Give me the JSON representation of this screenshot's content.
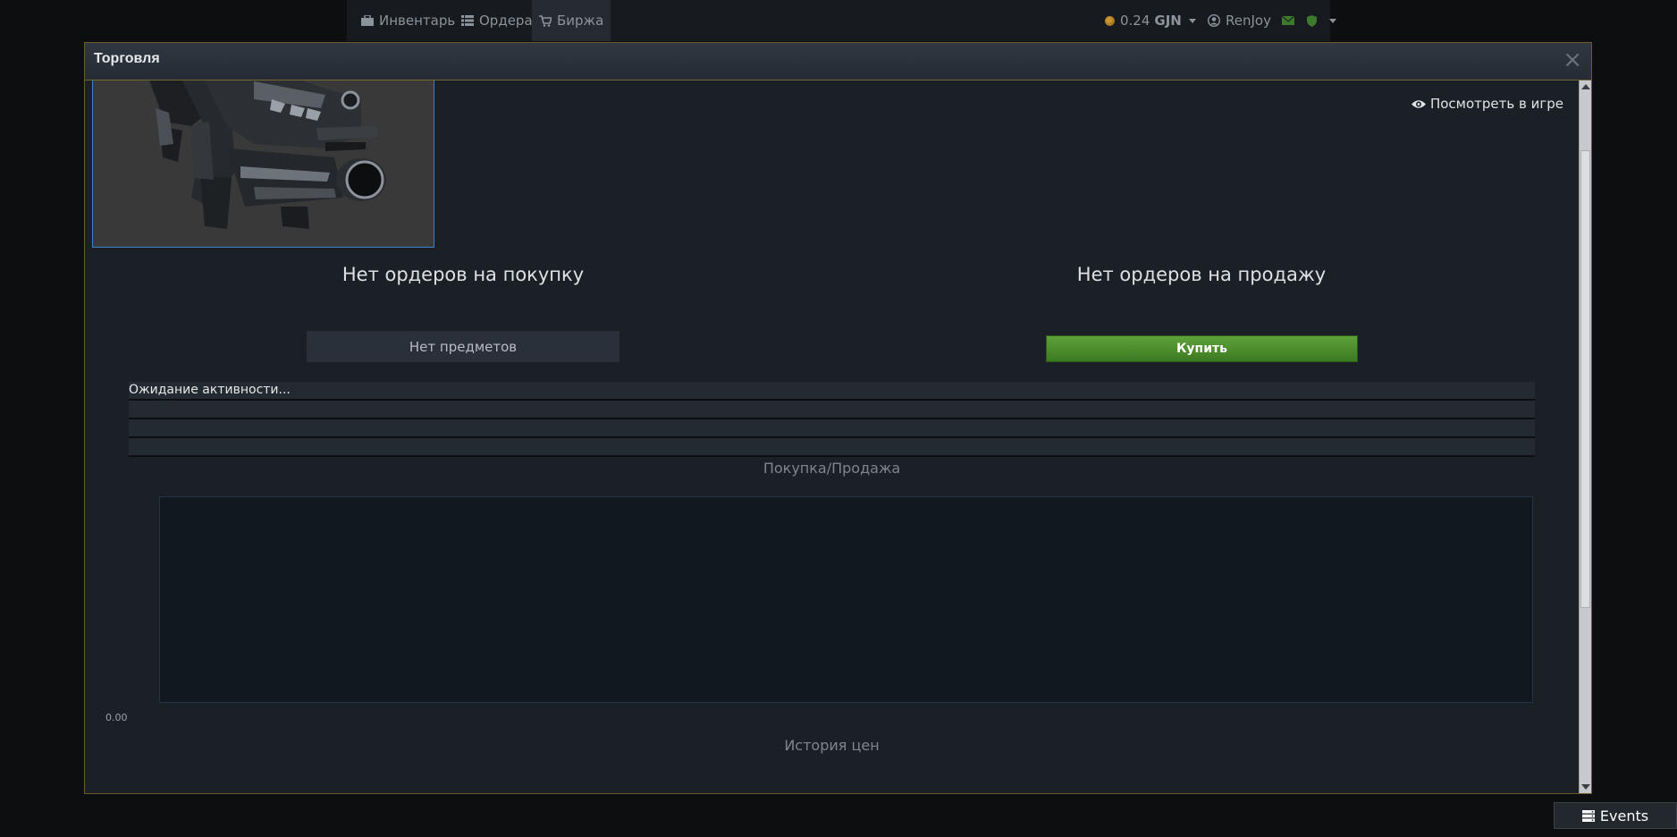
{
  "nav": {
    "inventory": "Инвентарь",
    "orders": "Ордера",
    "exchange": "Биржа",
    "balance": "0.24",
    "currency": "GJN",
    "username": "RenJoy"
  },
  "modal": {
    "title": "Торговля",
    "close": "×",
    "view_in_game": "Посмотреть в игре",
    "buy_orders_title": "Нет ордеров на покупку",
    "sell_orders_title": "Нет ордеров на продажу",
    "no_items_label": "Нет предметов",
    "buy_label": "Купить",
    "activity_status": "Ожидание активности...",
    "buy_sell_title": "Покупка/Продажа",
    "price_history_title": "История цен",
    "axis_zero": "0.00"
  },
  "events": {
    "label": "Events"
  },
  "colors": {
    "accent_gold": "#7a6632",
    "buy_green": "#4c8d2e",
    "image_border": "#3f7dd0"
  }
}
